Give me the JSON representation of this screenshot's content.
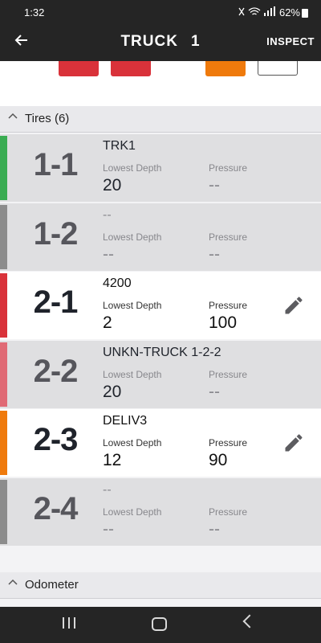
{
  "status_bar": {
    "time": "1:32",
    "battery": "62%"
  },
  "app_bar": {
    "title": "TRUCK",
    "truck_number": "1",
    "action_label": "INSPECT"
  },
  "truck_strip": {
    "swatch_colors": [
      "#d9323a",
      "#d9323a",
      "#ef7a0c",
      "#ffffff"
    ]
  },
  "tires_section": {
    "label": "Tires (6)",
    "lowest_depth_label": "Lowest Depth",
    "pressure_label": "Pressure",
    "tires": [
      {
        "position": "1-1",
        "name": "TRK1",
        "lowest_depth": "20",
        "pressure": "--",
        "status_color": "#3aac52",
        "editable": false
      },
      {
        "position": "1-2",
        "name": "--",
        "lowest_depth": "--",
        "pressure": "--",
        "status_color": "#8c8c8c",
        "editable": false
      },
      {
        "position": "2-1",
        "name": "4200",
        "lowest_depth": "2",
        "pressure": "100",
        "status_color": "#d9323a",
        "editable": true
      },
      {
        "position": "2-2",
        "name": "UNKN-TRUCK   1-2-2",
        "lowest_depth": "20",
        "pressure": "--",
        "status_color": "#e06a75",
        "editable": false
      },
      {
        "position": "2-3",
        "name": "DELIV3",
        "lowest_depth": "12",
        "pressure": "90",
        "status_color": "#ef7a0c",
        "editable": true
      },
      {
        "position": "2-4",
        "name": "--",
        "lowest_depth": "--",
        "pressure": "--",
        "status_color": "#8c8c8c",
        "editable": false
      }
    ]
  },
  "odometer_section": {
    "label": "Odometer"
  }
}
